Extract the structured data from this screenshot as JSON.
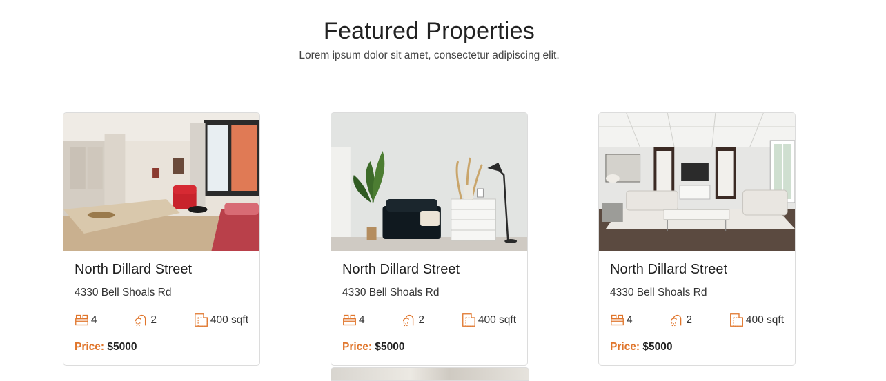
{
  "section": {
    "title": "Featured Properties",
    "subtitle": "Lorem ipsum dolor sit amet, consectetur adipiscing elit."
  },
  "cards": [
    {
      "title": "North Dillard Street",
      "address": "4330 Bell Shoals Rd",
      "bedrooms": "4",
      "bathrooms": "2",
      "area": "400 sqft",
      "price_label": "Price:",
      "price_value": "$5000"
    },
    {
      "title": "North Dillard Street",
      "address": "4330 Bell Shoals Rd",
      "bedrooms": "4",
      "bathrooms": "2",
      "area": "400 sqft",
      "price_label": "Price:",
      "price_value": "$5000"
    },
    {
      "title": "North Dillard Street",
      "address": "4330 Bell Shoals Rd",
      "bedrooms": "4",
      "bathrooms": "2",
      "area": "400 sqft",
      "price_label": "Price:",
      "price_value": "$5000"
    }
  ],
  "colors": {
    "accent": "#e0752b",
    "border": "#dcdcdc"
  }
}
